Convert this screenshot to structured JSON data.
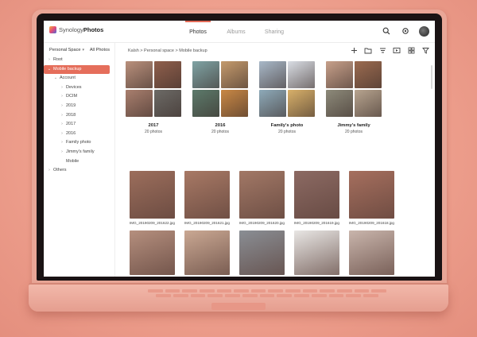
{
  "app": {
    "brand_prefix": "Synology",
    "brand_name": "Photos"
  },
  "tabs": [
    {
      "label": "Photos",
      "active": true
    },
    {
      "label": "Albums",
      "active": false
    },
    {
      "label": "Sharing",
      "active": false
    }
  ],
  "header_icons": [
    "search-icon",
    "settings-icon",
    "avatar"
  ],
  "sidebar": {
    "space_label": "Personal Space",
    "all_photos_label": "All Photos",
    "items": [
      {
        "label": "Root",
        "level": 0,
        "chevron": "right",
        "active": false
      },
      {
        "label": "Mobile backup",
        "level": 0,
        "chevron": "down",
        "active": true
      },
      {
        "label": "Account",
        "level": 1,
        "chevron": "down",
        "active": false
      },
      {
        "label": "Devices",
        "level": 2,
        "chevron": "right",
        "active": false
      },
      {
        "label": "DCIM",
        "level": 2,
        "chevron": "right",
        "active": false
      },
      {
        "label": "2019",
        "level": 2,
        "chevron": "right",
        "active": false
      },
      {
        "label": "2018",
        "level": 2,
        "chevron": "right",
        "active": false
      },
      {
        "label": "2017",
        "level": 2,
        "chevron": "right",
        "active": false
      },
      {
        "label": "2016",
        "level": 2,
        "chevron": "right",
        "active": false
      },
      {
        "label": "Family photo",
        "level": 2,
        "chevron": "right",
        "active": false
      },
      {
        "label": "Jimmy's family",
        "level": 2,
        "chevron": "right",
        "active": false
      },
      {
        "label": "Mobile",
        "level": 2,
        "chevron": "",
        "active": false
      },
      {
        "label": "Others",
        "level": 0,
        "chevron": "right",
        "active": false
      }
    ]
  },
  "breadcrumb": "Kalsh > Personal space > Mobile backup",
  "toolbar_icons": [
    "add-icon",
    "folder-add-icon",
    "sort-icon",
    "slideshow-icon",
    "grid-view-icon",
    "filter-icon"
  ],
  "albums": [
    {
      "name": "2017",
      "count": "20 photos",
      "colors": [
        "#b9907c",
        "#8f5f4c",
        "#a97f6e",
        "#6c6a66"
      ]
    },
    {
      "name": "2016",
      "count": "20 photos",
      "colors": [
        "#7fa3a4",
        "#c49a6c",
        "#5c7a6b",
        "#c98845"
      ]
    },
    {
      "name": "Family's photo",
      "count": "20 photos",
      "colors": [
        "#a8b8c8",
        "#d9dde4",
        "#8eaab9",
        "#d8b06a"
      ]
    },
    {
      "name": "Jimmy's family",
      "count": "20 photos",
      "colors": [
        "#c7a08a",
        "#9b6b50",
        "#8d8a7a",
        "#b7a48f"
      ]
    }
  ],
  "photos": [
    {
      "label": "IMG_20190209_201622.jpg",
      "color": "#9c6e5c"
    },
    {
      "label": "IMG_20190209_201621.jpg",
      "color": "#a87965"
    },
    {
      "label": "IMG_20190209_201620.jpg",
      "color": "#a27866"
    },
    {
      "label": "IMG_20190209_201619.jpg",
      "color": "#8c6a63"
    },
    {
      "label": "IMG_20190209_201618.jpg",
      "color": "#a66f5e"
    },
    {
      "label": "",
      "color": "#b58f7e"
    },
    {
      "label": "",
      "color": "#caa893"
    },
    {
      "label": "",
      "color": "#8a8e94"
    },
    {
      "label": "",
      "color": "#e8e6e4"
    },
    {
      "label": "",
      "color": "#c9b5ac"
    }
  ]
}
